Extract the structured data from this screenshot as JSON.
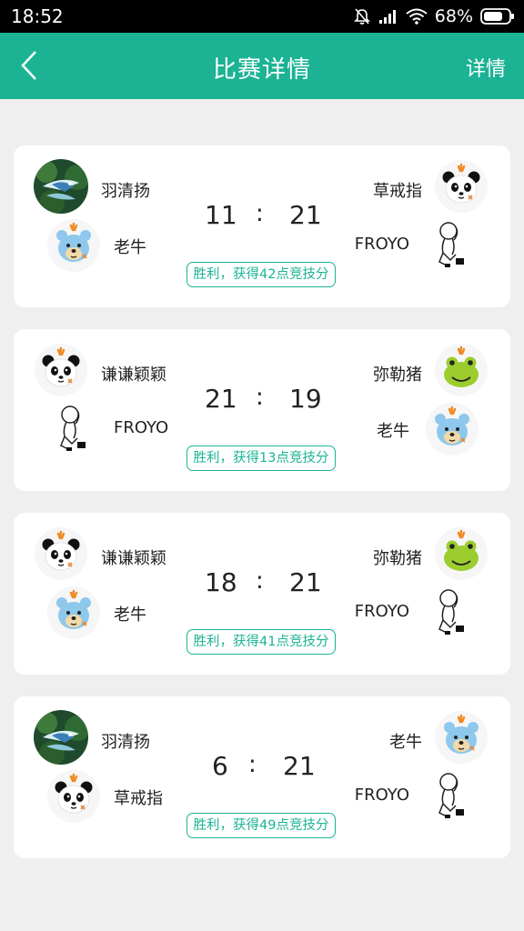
{
  "status_bar": {
    "time": "18:52",
    "battery": "68%",
    "icons": [
      "mute-icon",
      "signal-icon",
      "wifi-icon",
      "battery-icon"
    ]
  },
  "header": {
    "title": "比赛详情",
    "details_label": "详情",
    "back_icon": "back-arrow-icon",
    "background": "#1bb394"
  },
  "colors": {
    "accent": "#1bb394",
    "card": "#ffffff",
    "page": "#efefef"
  },
  "matches": [
    {
      "left_players": [
        {
          "name": "羽清扬",
          "avatar": "bird-photo"
        },
        {
          "name": "老牛",
          "avatar": "bear"
        }
      ],
      "right_players": [
        {
          "name": "草戒指",
          "avatar": "panda"
        },
        {
          "name": "FROYO",
          "avatar": "sketch-figure"
        }
      ],
      "score_left": "11",
      "score_right": "21",
      "separator": ":",
      "result": "胜利，获得42点竞技分"
    },
    {
      "left_players": [
        {
          "name": "谦谦颖颖",
          "avatar": "panda"
        },
        {
          "name": "FROYO",
          "avatar": "sketch-figure"
        }
      ],
      "right_players": [
        {
          "name": "弥勒猪",
          "avatar": "frog"
        },
        {
          "name": "老牛",
          "avatar": "bear"
        }
      ],
      "score_left": "21",
      "score_right": "19",
      "separator": ":",
      "result": "胜利，获得13点竞技分"
    },
    {
      "left_players": [
        {
          "name": "谦谦颖颖",
          "avatar": "panda"
        },
        {
          "name": "老牛",
          "avatar": "bear"
        }
      ],
      "right_players": [
        {
          "name": "弥勒猪",
          "avatar": "frog"
        },
        {
          "name": "FROYO",
          "avatar": "sketch-figure"
        }
      ],
      "score_left": "18",
      "score_right": "21",
      "separator": ":",
      "result": "胜利，获得41点竞技分"
    },
    {
      "left_players": [
        {
          "name": "羽清扬",
          "avatar": "bird-photo"
        },
        {
          "name": "草戒指",
          "avatar": "panda"
        }
      ],
      "right_players": [
        {
          "name": "老牛",
          "avatar": "bear"
        },
        {
          "name": "FROYO",
          "avatar": "sketch-figure"
        }
      ],
      "score_left": "6",
      "score_right": "21",
      "separator": ":",
      "result": "胜利，获得49点竞技分"
    }
  ]
}
